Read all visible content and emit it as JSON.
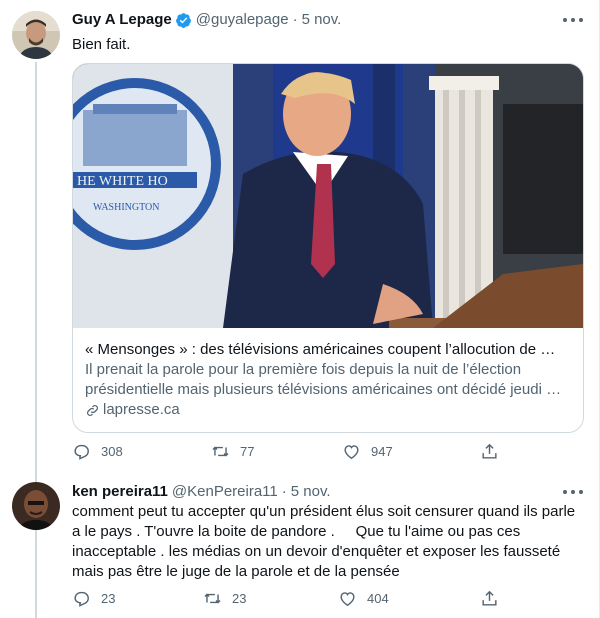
{
  "tweets": [
    {
      "name": "Guy A Lepage",
      "handle": "@guyalepage",
      "separator": "·",
      "time": "5 nov.",
      "text": "Bien fait.",
      "verified": true,
      "card": {
        "title": "« Mensonges » : des télévisions américaines coupent l’allocution de …",
        "description": "Il prenait la parole pour la première fois depuis la nuit de l’élection présidentielle mais plusieurs télévisions américaines ont décidé jeudi …",
        "domain": "lapresse.ca",
        "image_text_1": "HE WHITE HO",
        "image_text_2": "WASHINGTON"
      },
      "replies": "308",
      "retweets": "77",
      "likes": "947"
    },
    {
      "name": "ken pereira11",
      "handle": "@KenPereira11",
      "separator": "·",
      "time": "5 nov.",
      "text": "comment peut tu accepter qu'un président élus soit censurer quand ils parle a le pays . T'ouvre la boite de pandore .     Que tu l'aime ou pas ces inacceptable . les médias on un devoir d'enquêter et exposer les fausseté mais pas être le juge de la parole et de la pensée",
      "replies": "23",
      "retweets": "23",
      "likes": "404"
    }
  ],
  "colors": {
    "verified": "#1d9bf0",
    "text": "#0f1419",
    "muted": "#536471",
    "border": "#cfd9de"
  },
  "icons": [
    "verified-badge-icon",
    "more-icon",
    "link-icon",
    "reply-icon",
    "retweet-icon",
    "like-icon",
    "share-icon"
  ]
}
